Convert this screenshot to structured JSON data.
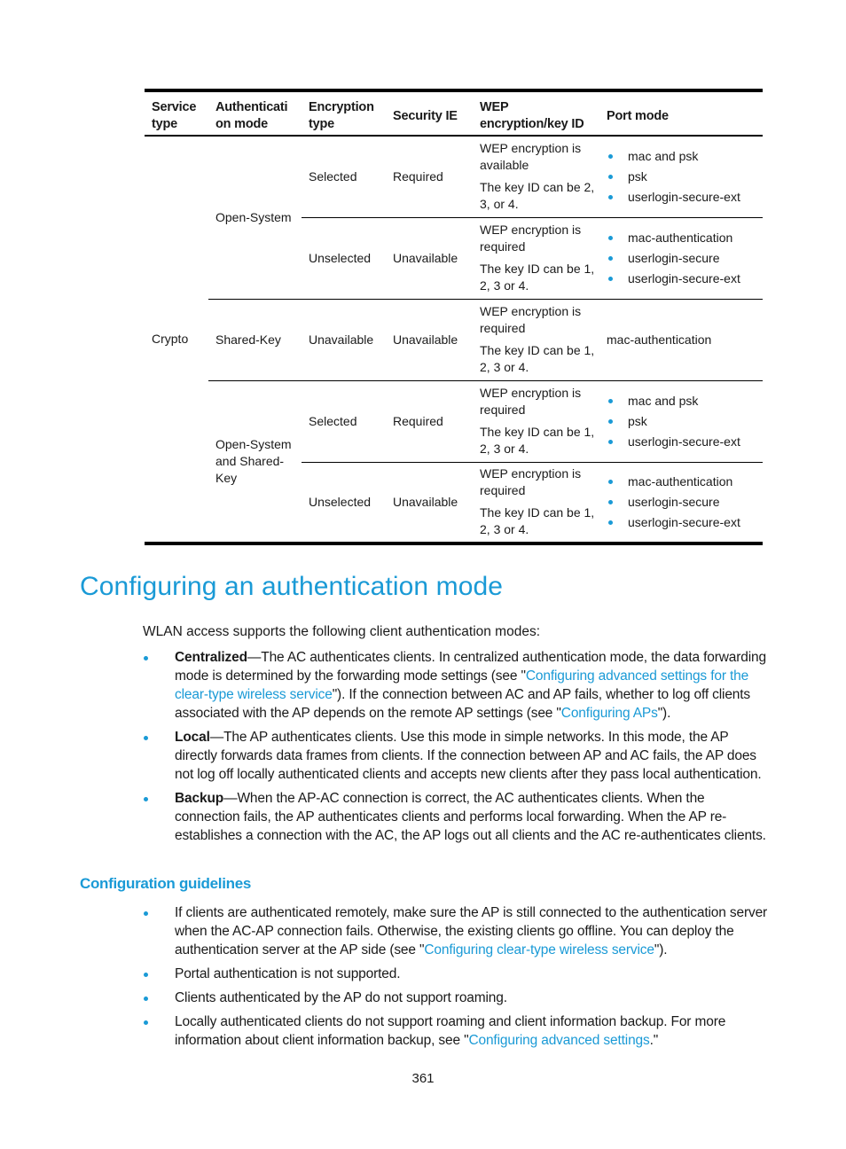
{
  "table": {
    "headers": {
      "service_type": "Service type",
      "auth_mode": "Authenticati on mode",
      "encryption_type": "Encryption type",
      "security_ie": "Security IE",
      "wep": "WEP encryption/key ID",
      "port_mode": "Port mode"
    },
    "service_type": "Crypto",
    "groups": [
      {
        "auth_mode": "Open-System",
        "rows": [
          {
            "encryption_type": "Selected",
            "security_ie": "Required",
            "wep_line1": "WEP encryption is available",
            "wep_line2": "The key ID can be 2, 3, or 4.",
            "port_modes": [
              "mac and psk",
              "psk",
              "userlogin-secure-ext"
            ]
          },
          {
            "encryption_type": "Unselected",
            "security_ie": "Unavailable",
            "wep_line1": "WEP encryption is required",
            "wep_line2": "The key ID can be 1, 2, 3 or 4.",
            "port_modes": [
              "mac-authentication",
              "userlogin-secure",
              "userlogin-secure-ext"
            ]
          }
        ]
      },
      {
        "auth_mode": "Shared-Key",
        "rows": [
          {
            "encryption_type": "Unavailable",
            "security_ie": "Unavailable",
            "wep_line1": "WEP encryption is required",
            "wep_line2": "The key ID can be 1, 2, 3 or 4.",
            "port_mode_text": "mac-authentication"
          }
        ]
      },
      {
        "auth_mode": "Open-System and Shared-Key",
        "rows": [
          {
            "encryption_type": "Selected",
            "security_ie": "Required",
            "wep_line1": "WEP encryption is required",
            "wep_line2": "The key ID can be 1, 2, 3 or 4.",
            "port_modes": [
              "mac and psk",
              "psk",
              "userlogin-secure-ext"
            ]
          },
          {
            "encryption_type": "Unselected",
            "security_ie": "Unavailable",
            "wep_line1": "WEP encryption is required",
            "wep_line2": "The key ID can be 1, 2, 3 or 4.",
            "port_modes": [
              "mac-authentication",
              "userlogin-secure",
              "userlogin-secure-ext"
            ]
          }
        ]
      }
    ]
  },
  "section": {
    "title": "Configuring an authentication mode",
    "intro": "WLAN access supports the following client authentication modes:",
    "modes": [
      {
        "term": "Centralized",
        "text1": "—The AC authenticates clients. In centralized authentication mode, the data forwarding mode is determined by the forwarding mode settings (see \"",
        "link1": "Configuring advanced settings for the clear-type wireless service",
        "text2": "\"). If the connection between AC and AP fails, whether to log off clients associated with the AP depends on the remote AP settings (see \"",
        "link2": "Configuring APs",
        "text3": "\")."
      },
      {
        "term": "Local",
        "text1": "—The AP authenticates clients. Use this mode in simple networks. In this mode, the AP directly forwards data frames from clients. If the connection between AP and AC fails, the AP does not log off locally authenticated clients and accepts new clients after they pass local authentication."
      },
      {
        "term": "Backup",
        "text1": "—When the AP-AC connection is correct, the AC authenticates clients. When the connection fails, the AP authenticates clients and performs local forwarding. When the AP re-establishes a connection with the AC, the AP logs out all clients and the AC re-authenticates clients."
      }
    ]
  },
  "guidelines": {
    "title": "Configuration guidelines",
    "items": [
      {
        "text1": "If clients are authenticated remotely, make sure the AP is still connected to the authentication server when the AC-AP connection fails. Otherwise, the existing clients go offline. You can deploy the authentication server at the AP side (see \"",
        "link": "Configuring clear-type wireless service",
        "text2": "\")."
      },
      {
        "text1": "Portal authentication is not supported."
      },
      {
        "text1": "Clients authenticated by the AP do not support roaming."
      },
      {
        "text1": "Locally authenticated clients do not support roaming and client information backup. For more information about client information backup, see \"",
        "link": "Configuring advanced settings",
        "text2": ".\""
      }
    ]
  },
  "page_number": "361",
  "colors": {
    "accent": "#1a9ad6",
    "text": "#1a1a1a"
  }
}
